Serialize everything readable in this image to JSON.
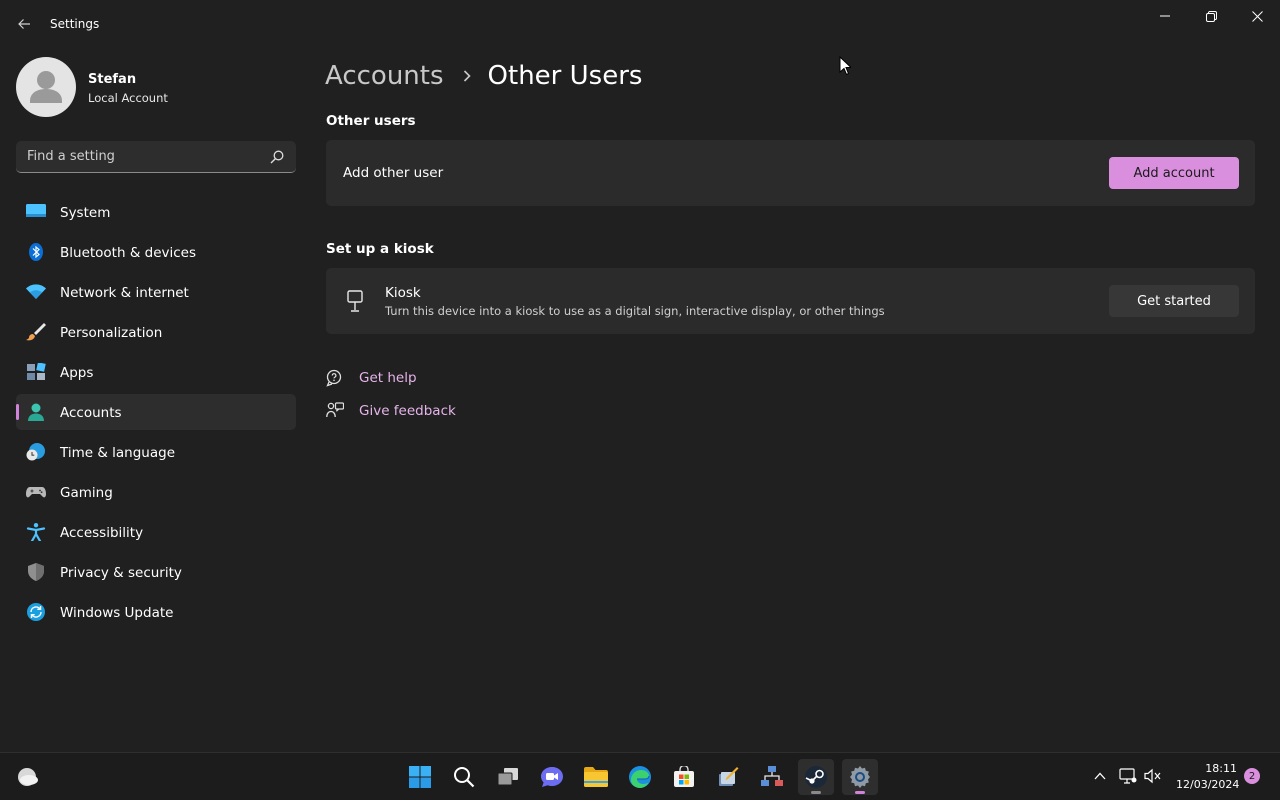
{
  "window": {
    "title": "Settings"
  },
  "profile": {
    "name": "Stefan",
    "account_type": "Local Account"
  },
  "search": {
    "placeholder": "Find a setting"
  },
  "sidebar": {
    "items": [
      {
        "label": "System",
        "icon": "monitor-icon",
        "color": "#4cc2ff"
      },
      {
        "label": "Bluetooth & devices",
        "icon": "bluetooth-icon",
        "color": "#0078d4"
      },
      {
        "label": "Network & internet",
        "icon": "wifi-icon",
        "color": "#4cc2ff"
      },
      {
        "label": "Personalization",
        "icon": "brush-icon",
        "color": "#f2a25c"
      },
      {
        "label": "Apps",
        "icon": "apps-icon",
        "color": "#8a9ba8"
      },
      {
        "label": "Accounts",
        "icon": "person-icon",
        "color": "#3cb9a8",
        "active": true
      },
      {
        "label": "Time & language",
        "icon": "globe-clock-icon",
        "color": "#4cc2ff"
      },
      {
        "label": "Gaming",
        "icon": "gamepad-icon",
        "color": "#b0b0b0"
      },
      {
        "label": "Accessibility",
        "icon": "accessibility-icon",
        "color": "#4cc2ff"
      },
      {
        "label": "Privacy & security",
        "icon": "shield-icon",
        "color": "#8d8d8d"
      },
      {
        "label": "Windows Update",
        "icon": "refresh-icon",
        "color": "#1a9fe0"
      }
    ]
  },
  "breadcrumb": {
    "parent": "Accounts",
    "current": "Other Users"
  },
  "other_users": {
    "section_title": "Other users",
    "row_label": "Add other user",
    "button_label": "Add account"
  },
  "kiosk": {
    "section_title": "Set up a kiosk",
    "title": "Kiosk",
    "description": "Turn this device into a kiosk to use as a digital sign, interactive display, or other things",
    "button_label": "Get started"
  },
  "links": {
    "help": "Get help",
    "feedback": "Give feedback"
  },
  "taskbar": {
    "time": "18:11",
    "date": "12/03/2024",
    "notification_count": "2"
  },
  "colors": {
    "accent": "#d98fdd",
    "background": "#202020",
    "card": "#2b2b2b"
  }
}
